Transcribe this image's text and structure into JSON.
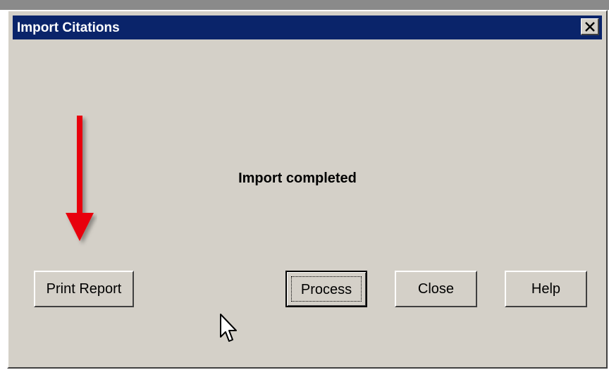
{
  "window": {
    "title": "Import Citations",
    "close_glyph": "✕"
  },
  "message": "Import completed",
  "buttons": {
    "print_report": "Print Report",
    "process": "Process",
    "close": "Close",
    "help": "Help"
  },
  "annotation": {
    "arrow_color": "#e8000b",
    "arrow_icon": "down-arrow-icon"
  },
  "colors": {
    "titlebar": "#0a246a",
    "dialog_face": "#d4d0c8"
  }
}
